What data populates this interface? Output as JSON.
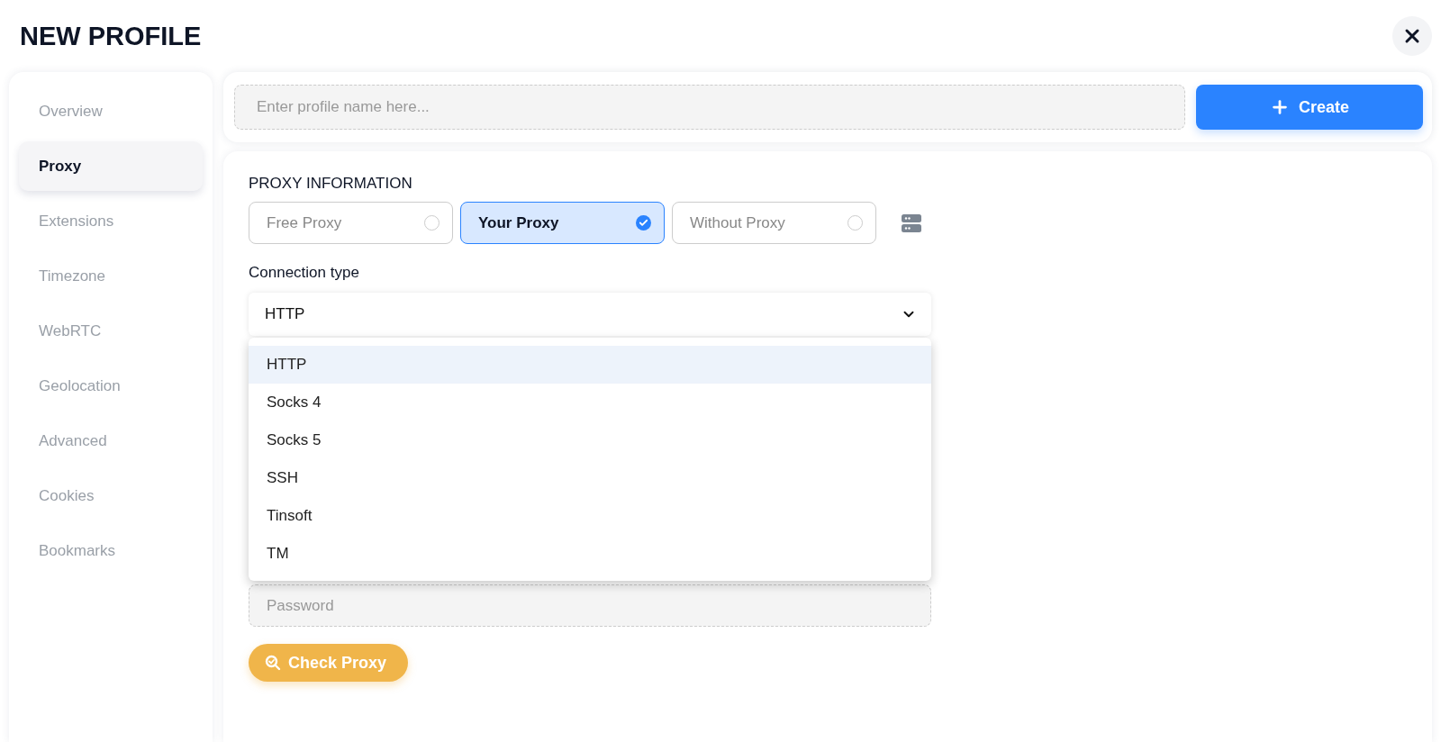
{
  "title": "NEW PROFILE",
  "sidebar": {
    "items": [
      {
        "label": "Overview",
        "selected": false
      },
      {
        "label": "Proxy",
        "selected": true
      },
      {
        "label": "Extensions",
        "selected": false
      },
      {
        "label": "Timezone",
        "selected": false
      },
      {
        "label": "WebRTC",
        "selected": false
      },
      {
        "label": "Geolocation",
        "selected": false
      },
      {
        "label": "Advanced",
        "selected": false
      },
      {
        "label": "Cookies",
        "selected": false
      },
      {
        "label": "Bookmarks",
        "selected": false
      }
    ]
  },
  "profile_name": {
    "placeholder": "Enter profile name here..."
  },
  "create_button": "Create",
  "proxy": {
    "heading": "PROXY INFORMATION",
    "options": [
      {
        "label": "Free Proxy",
        "selected": false
      },
      {
        "label": "Your Proxy",
        "selected": true
      },
      {
        "label": "Without Proxy",
        "selected": false
      }
    ],
    "connection_label": "Connection type",
    "connection_value": "HTTP",
    "dropdown": {
      "expanded": true,
      "items": [
        {
          "label": "HTTP",
          "selected": true
        },
        {
          "label": "Socks 4",
          "selected": false
        },
        {
          "label": "Socks 5",
          "selected": false
        },
        {
          "label": "SSH",
          "selected": false
        },
        {
          "label": "Tinsoft",
          "selected": false
        },
        {
          "label": "TM",
          "selected": false
        }
      ]
    },
    "password": {
      "placeholder": "Password"
    },
    "check_button": "Check Proxy"
  }
}
